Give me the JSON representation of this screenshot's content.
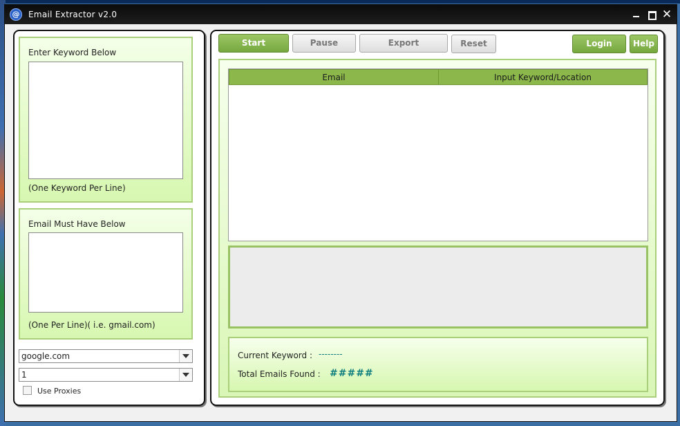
{
  "window": {
    "title": "Email Extractor  v2.0",
    "controls": {
      "minimize": "_",
      "maximize": "□",
      "close": "✕"
    }
  },
  "left": {
    "keyword_box": {
      "title": "Enter Keyword Below",
      "hint": "(One Keyword Per Line)",
      "value": ""
    },
    "email_box": {
      "title": "Email Must Have Below",
      "hint": "(One Per Line)( i.e. gmail.com)",
      "value": ""
    },
    "engine_select": {
      "value": "google.com"
    },
    "count_select": {
      "value": "1"
    },
    "use_proxies": {
      "label": "Use Proxies",
      "checked": false
    }
  },
  "toolbar": {
    "start": "Start",
    "pause": "Pause",
    "export": "Export",
    "reset": "Reset",
    "login": "Login",
    "help": "Help"
  },
  "table": {
    "columns": [
      "Email",
      "Input Keyword/Location"
    ],
    "rows": []
  },
  "status": {
    "current_keyword_label": "Current Keyword :",
    "current_keyword_value": "--------",
    "total_emails_label": "Total Emails Found :",
    "total_emails_value": "#####"
  },
  "colors": {
    "accent_green": "#8cb84b",
    "value_teal": "#0c7d7d",
    "title_bar": "#111111"
  }
}
